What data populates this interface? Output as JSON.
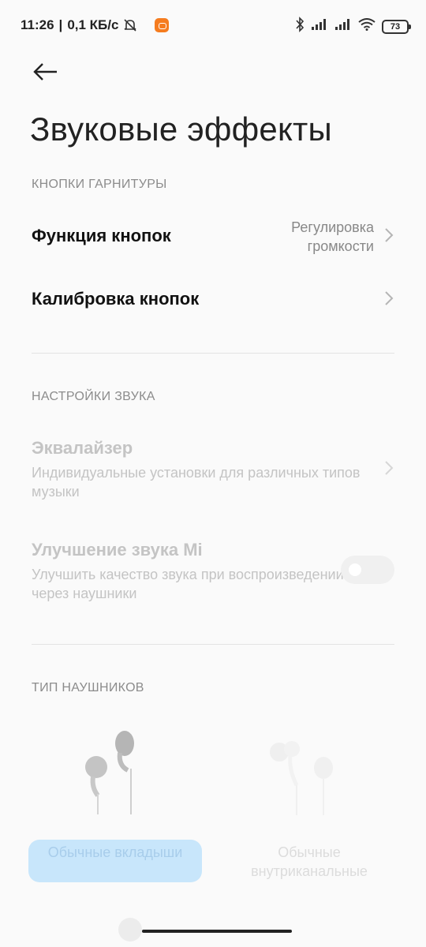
{
  "status_bar": {
    "time": "11:26",
    "speed": "0,1 КБ/с",
    "battery": "73"
  },
  "header": {
    "title": "Звуковые эффекты"
  },
  "sections": {
    "headset_buttons": {
      "label": "КНОПКИ ГАРНИТУРЫ",
      "button_function": {
        "title": "Функция кнопок",
        "value_line1": "Регулировка",
        "value_line2": "громкости"
      },
      "button_calibration": {
        "title": "Калибровка кнопок"
      }
    },
    "sound_settings": {
      "label": "НАСТРОЙКИ ЗВУКА",
      "equalizer": {
        "title": "Эквалайзер",
        "subtitle": "Индивидуальные установки для различных типов музыки"
      },
      "mi_sound": {
        "title": "Улучшение звука Mi",
        "subtitle": "Улучшить качество звука при воспроизведении через наушники",
        "enabled": false
      }
    },
    "headphone_type": {
      "label": "ТИП НАУШНИКОВ",
      "options": [
        {
          "label": "Обычные вкладыши",
          "selected": true
        },
        {
          "label": "Обычные внутриканальные",
          "selected": false
        }
      ]
    }
  },
  "colors": {
    "accent_selected_bg": "#c8e6fb",
    "muted_text": "#8c8c8c",
    "disabled_text": "#c4c4c4"
  }
}
